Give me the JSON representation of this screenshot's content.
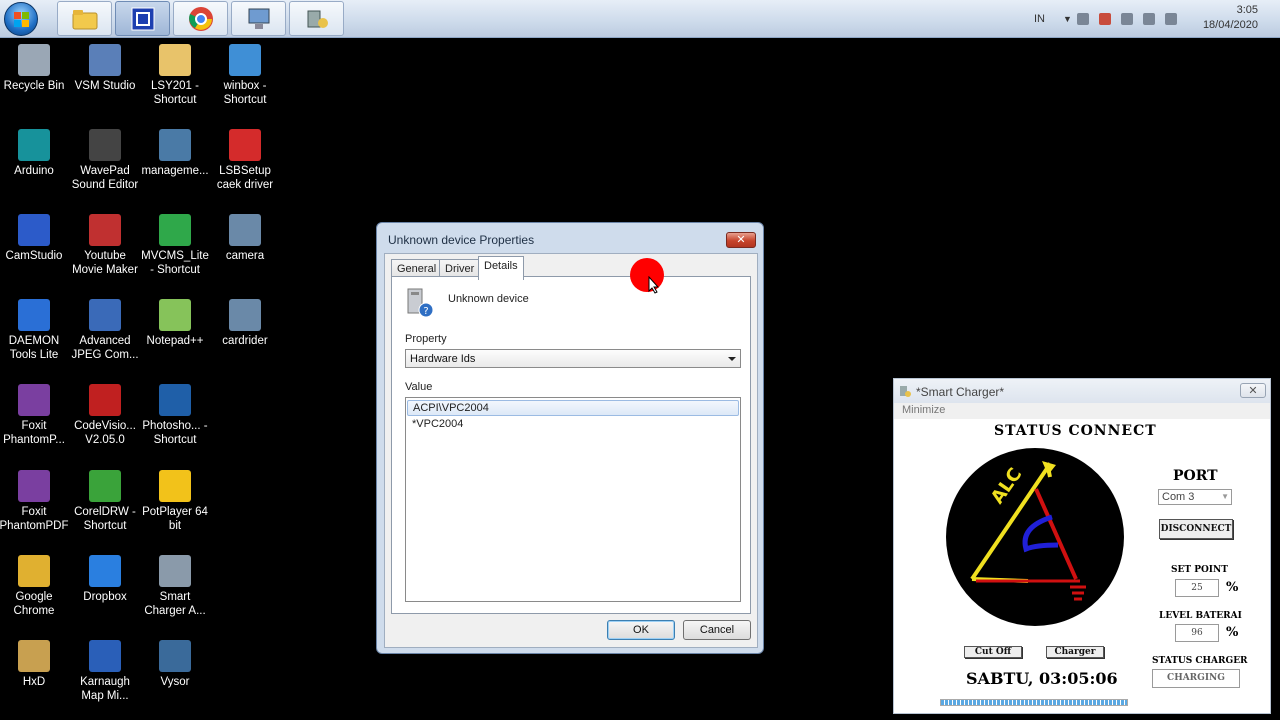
{
  "taskbar": {
    "pinned": [
      {
        "name": "explorer-button"
      },
      {
        "name": "camstudio-button"
      },
      {
        "name": "chrome-button"
      },
      {
        "name": "device-manager-button"
      },
      {
        "name": "smart-charger-button"
      }
    ],
    "lang": "IN",
    "time": "3:05",
    "date": "18/04/2020"
  },
  "desktop": {
    "icons": [
      {
        "label": "Recycle Bin",
        "icon": "recycle-bin-icon",
        "color": "#9aa7b5"
      },
      {
        "label": "VSM Studio",
        "icon": "vsm-studio-icon",
        "color": "#5a7fb8"
      },
      {
        "label": "LSY201 - Shortcut",
        "icon": "lsy201-icon",
        "color": "#e8c36a"
      },
      {
        "label": "winbox - Shortcut",
        "icon": "winbox-icon",
        "color": "#3f8fd6"
      },
      {
        "label": "Arduino",
        "icon": "arduino-icon",
        "color": "#17929b"
      },
      {
        "label": "WavePad Sound Editor",
        "icon": "wavepad-icon",
        "color": "#444"
      },
      {
        "label": "manageme...",
        "icon": "management-icon",
        "color": "#4a7aa6"
      },
      {
        "label": "LSBSetup caek driver",
        "icon": "lsbsetup-icon",
        "color": "#d42b2b"
      },
      {
        "label": "CamStudio",
        "icon": "camstudio-icon",
        "color": "#2c5bc9"
      },
      {
        "label": "Youtube Movie Maker",
        "icon": "youtube-movie-maker-icon",
        "color": "#c03030"
      },
      {
        "label": "MVCMS_Lite - Shortcut",
        "icon": "mvcms-icon",
        "color": "#2fa84a"
      },
      {
        "label": "camera",
        "icon": "camera-icon",
        "color": "#6a89a8"
      },
      {
        "label": "DAEMON Tools Lite",
        "icon": "daemon-tools-icon",
        "color": "#2a6fd6"
      },
      {
        "label": "Advanced JPEG Com...",
        "icon": "jpeg-compressor-icon",
        "color": "#3a6ab8"
      },
      {
        "label": "Notepad++",
        "icon": "notepad-plus-plus-icon",
        "color": "#86c35a"
      },
      {
        "label": "cardrider",
        "icon": "cardrider-icon",
        "color": "#6a89a8"
      },
      {
        "label": "Foxit PhantomP...",
        "icon": "foxit-phantom-icon",
        "color": "#7a3fa0"
      },
      {
        "label": "CodeVisio... V2.05.0",
        "icon": "codevision-icon",
        "color": "#c02020"
      },
      {
        "label": "Photosho... - Shortcut",
        "icon": "photoshop-icon",
        "color": "#1f5fa8"
      },
      {
        "label": "Foxit PhantomPDF",
        "icon": "foxit-pdf-icon",
        "color": "#7a3fa0"
      },
      {
        "label": "CorelDRW - Shortcut",
        "icon": "coreldraw-icon",
        "color": "#3aa33a"
      },
      {
        "label": "PotPlayer 64 bit",
        "icon": "potplayer-icon",
        "color": "#f2c21a"
      },
      {
        "label": "Google Chrome",
        "icon": "chrome-icon",
        "color": "#e0b030"
      },
      {
        "label": "Dropbox",
        "icon": "dropbox-icon",
        "color": "#2a7fe0"
      },
      {
        "label": "Smart Charger A...",
        "icon": "smart-charger-icon",
        "color": "#8a9aaa"
      },
      {
        "label": "HxD",
        "icon": "hxd-icon",
        "color": "#c8a050"
      },
      {
        "label": "Karnaugh Map Mi...",
        "icon": "karnaugh-map-icon",
        "color": "#2a5fb8"
      },
      {
        "label": "Vysor",
        "icon": "vysor-icon",
        "color": "#3a6a9a"
      }
    ]
  },
  "properties": {
    "title": "Unknown device Properties",
    "close": "✕",
    "tabs": [
      "General",
      "Driver",
      "Details"
    ],
    "device_name": "Unknown device",
    "property_label": "Property",
    "property_value": "Hardware Ids",
    "value_label": "Value",
    "values": [
      "ACPI\\VPC2004",
      "*VPC2004"
    ],
    "ok": "OK",
    "cancel": "Cancel"
  },
  "charger": {
    "title": "*Smart Charger*",
    "close": "✕",
    "menu": "Minimize",
    "status": "STATUS CONNECT",
    "logo_text": "ALC",
    "port_label": "PORT",
    "port_value": "Com 3",
    "disconnect": "DISCONNECT",
    "setpoint_label": "SET POINT",
    "setpoint_value": "25",
    "level_label": "LEVEL BATERAI",
    "level_value": "96",
    "percent": "%",
    "status_charger_label": "STATUS CHARGER",
    "status_charger_value": "CHARGING",
    "cutoff": "Cut Off",
    "charger": "Charger",
    "datetime": "SABTU, 03:05:06",
    "progress": 1.0
  }
}
